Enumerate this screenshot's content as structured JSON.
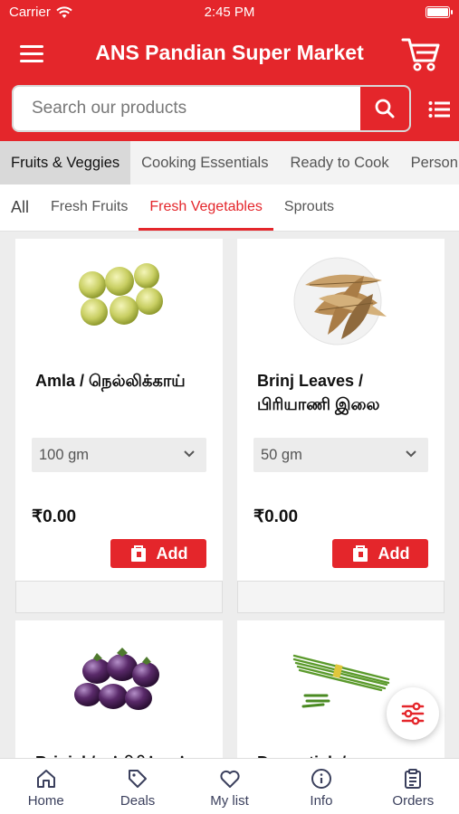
{
  "status_bar": {
    "carrier": "Carrier",
    "time": "2:45 PM"
  },
  "header": {
    "title": "ANS Pandian Super Market"
  },
  "search": {
    "placeholder": "Search our products"
  },
  "category_tabs": [
    {
      "label": "Fruits & Veggies",
      "active": true
    },
    {
      "label": "Cooking Essentials"
    },
    {
      "label": "Ready to Cook"
    },
    {
      "label": "Person"
    }
  ],
  "sub_tabs": [
    {
      "label": "All"
    },
    {
      "label": "Fresh Fruits"
    },
    {
      "label": "Fresh Vegetables",
      "active": true
    },
    {
      "label": "Sprouts"
    }
  ],
  "products": [
    {
      "name": "Amla / நெல்லிக்காய்",
      "variant": "100 gm",
      "price": "₹0.00",
      "add_label": "Add",
      "icon": "amla-icon"
    },
    {
      "name": "Brinj Leaves / பிரியாணி இலை",
      "variant": "50 gm",
      "price": "₹0.00",
      "add_label": "Add",
      "icon": "bay-leaves-icon"
    },
    {
      "name": "Brinjal / கத்திரிக்காய்",
      "icon": "brinjal-icon"
    },
    {
      "name": "Drumstick / முருங்கைக்காய்",
      "icon": "drumstick-icon"
    }
  ],
  "bottom_nav": [
    {
      "label": "Home",
      "icon": "home-icon"
    },
    {
      "label": "Deals",
      "icon": "tag-icon"
    },
    {
      "label": "My list",
      "icon": "heart-icon"
    },
    {
      "label": "Info",
      "icon": "info-icon"
    },
    {
      "label": "Orders",
      "icon": "clipboard-icon"
    }
  ],
  "colors": {
    "brand": "#e4262b",
    "nav_text": "#3a3f5c"
  }
}
